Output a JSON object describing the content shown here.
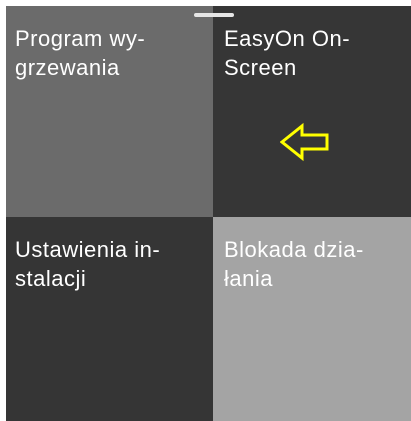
{
  "tiles": [
    {
      "label": "Program wy-\ngrzewania",
      "color": "#6b6b6b"
    },
    {
      "label": "EasyOn On-\nScreen",
      "color": "#363636"
    },
    {
      "label": "Ustawienia in-\nstalacji",
      "color": "#353535"
    },
    {
      "label": "Blokada dzia-\nłania",
      "color": "#a4a4a4"
    }
  ],
  "hint": {
    "icon": "left-arrow-icon",
    "color": "#ffff00"
  },
  "handle": {
    "icon": "drag-handle",
    "color": "#e6e6e6"
  }
}
